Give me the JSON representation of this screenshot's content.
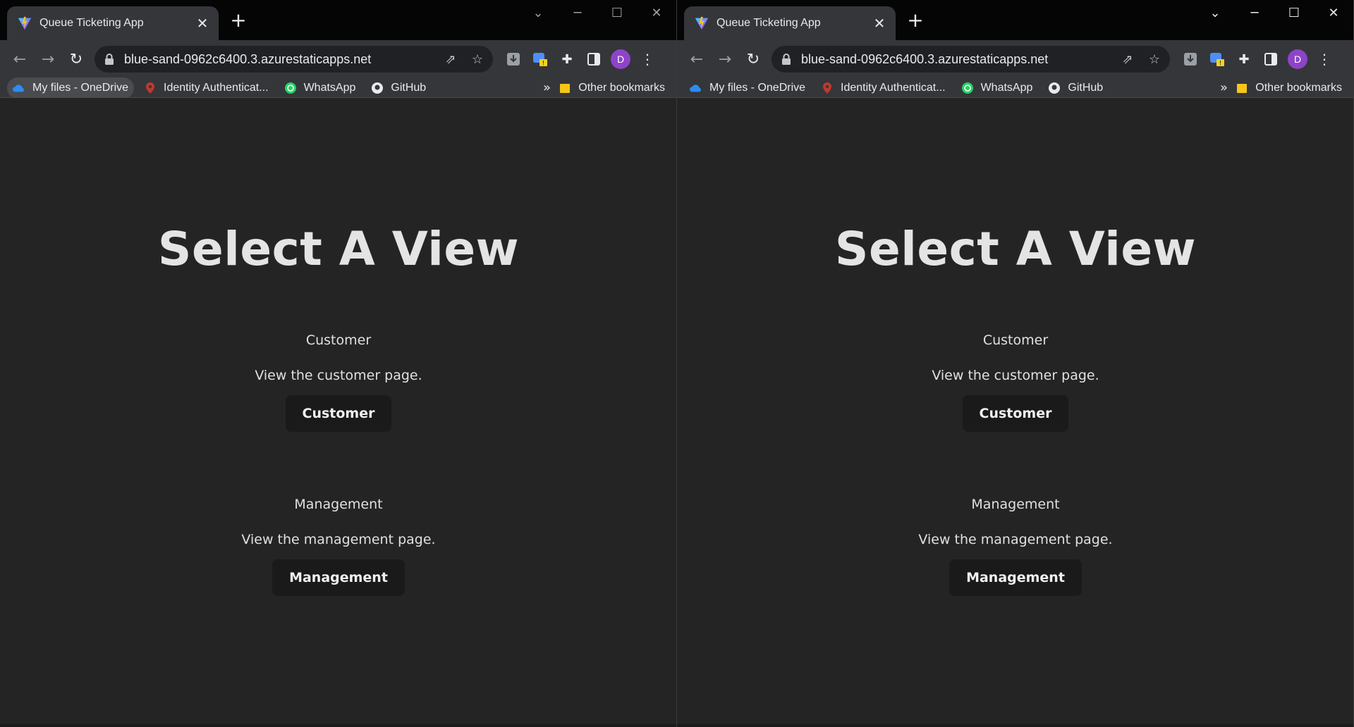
{
  "browser": {
    "tab_title": "Queue Ticketing App",
    "tab_close": "✕",
    "new_tab": "+",
    "url": "blue-sand-0962c6400.3.azurestaticapps.net",
    "avatar_letter": "D",
    "extension_badge": "!",
    "bookmarks": [
      {
        "label": "My files - OneDrive",
        "icon": "onedrive-icon"
      },
      {
        "label": "Identity Authenticat...",
        "icon": "location-pin-icon"
      },
      {
        "label": "WhatsApp",
        "icon": "whatsapp-icon"
      },
      {
        "label": "GitHub",
        "icon": "github-icon"
      }
    ],
    "bookmarks_more": "»",
    "other_bookmarks": "Other bookmarks"
  },
  "page": {
    "title": "Select A View",
    "sections": [
      {
        "heading": "Customer",
        "description": "View the customer page.",
        "button": "Customer"
      },
      {
        "heading": "Management",
        "description": "View the management page.",
        "button": "Management"
      }
    ]
  },
  "colors": {
    "page_bg": "#242424",
    "chrome_bg": "#35363a",
    "tabstrip_bg": "#050505",
    "button_bg": "#1a1a1a",
    "avatar": "#8e44c9"
  }
}
